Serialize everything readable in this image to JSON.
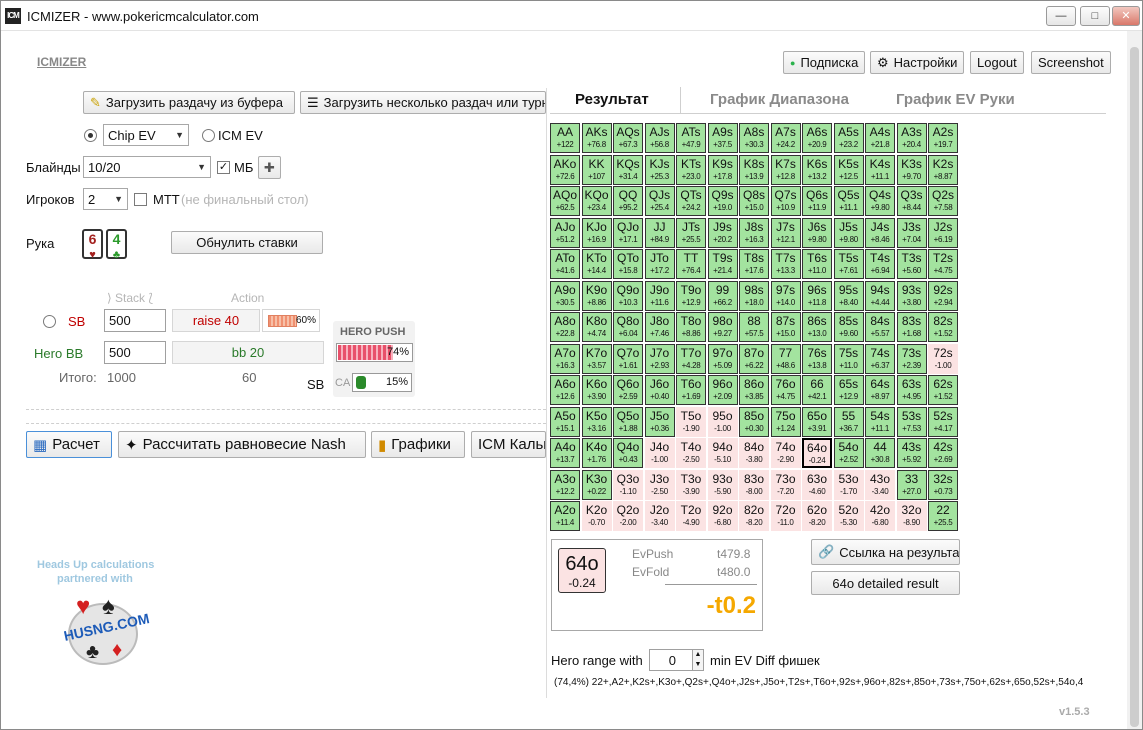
{
  "window": {
    "title": "ICMIZER - www.pokericmcalculator.com",
    "icon": "ICM"
  },
  "brand": "ICMIZER",
  "top_buttons": {
    "subscription": "Подписка",
    "settings": "Настройки",
    "logout": "Logout",
    "screenshot": "Screenshot"
  },
  "load_buttons": {
    "clipboard": "Загрузить раздачу из буфера",
    "multiple": "Загрузить несколько раздач или турнир"
  },
  "ev_mode": {
    "chip_ev": "Chip EV",
    "icm_ev": "ICM EV"
  },
  "blinds": {
    "label": "Блайнды",
    "value": "10/20",
    "bb_label": "МБ"
  },
  "players": {
    "label": "Игроков",
    "value": "2",
    "mtt_label": "МТТ",
    "mtt_note": "(не финальный стол)"
  },
  "hand": {
    "label": "Рука",
    "card1": "6",
    "card2": "4",
    "reset": "Обнулить ставки"
  },
  "columns": {
    "stack": "Stack",
    "action": "Action"
  },
  "sb": {
    "label": "SB",
    "stack": "500",
    "action": "raise 40",
    "percent": "60%"
  },
  "bb": {
    "label": "Hero",
    "pos": "BB",
    "stack": "500",
    "action": "bb 20"
  },
  "totals": {
    "label": "Итого:",
    "stack": "1000",
    "action": "60"
  },
  "hero_push": {
    "title": "HERO PUSH",
    "percent": "74%",
    "sb_label": "SB",
    "ca_label": "CA",
    "ca_percent": "15%",
    "push_fraction": 0.74,
    "ca_fraction": 0.15,
    "sb_fraction": 0.6
  },
  "action_buttons": {
    "calc": "Расчет",
    "nash": "Рассчитать равновесие Nash",
    "graphs": "Графики",
    "icm": "ICM Калькулятор"
  },
  "partner": {
    "line1": "Heads Up calculations",
    "line2": "partnered with",
    "logo": "HUSNG.COM"
  },
  "tabs": {
    "result": "Результат",
    "range": "График Диапазона",
    "ev": "График EV Руки"
  },
  "grid": [
    [
      [
        "AA",
        "+122",
        1
      ],
      [
        "AKs",
        "+76.8",
        1
      ],
      [
        "AQs",
        "+67.3",
        1
      ],
      [
        "AJs",
        "+56.8",
        1
      ],
      [
        "ATs",
        "+47.9",
        1
      ],
      [
        "A9s",
        "+37.5",
        1
      ],
      [
        "A8s",
        "+30.3",
        1
      ],
      [
        "A7s",
        "+24.2",
        1
      ],
      [
        "A6s",
        "+20.9",
        1
      ],
      [
        "A5s",
        "+23.2",
        1
      ],
      [
        "A4s",
        "+21.8",
        1
      ],
      [
        "A3s",
        "+20.4",
        1
      ],
      [
        "A2s",
        "+19.7",
        1
      ]
    ],
    [
      [
        "AKo",
        "+72.6",
        1
      ],
      [
        "KK",
        "+107",
        1
      ],
      [
        "KQs",
        "+31.4",
        1
      ],
      [
        "KJs",
        "+25.3",
        1
      ],
      [
        "KTs",
        "+23.0",
        1
      ],
      [
        "K9s",
        "+17.8",
        1
      ],
      [
        "K8s",
        "+13.9",
        1
      ],
      [
        "K7s",
        "+12.8",
        1
      ],
      [
        "K6s",
        "+13.2",
        1
      ],
      [
        "K5s",
        "+12.5",
        1
      ],
      [
        "K4s",
        "+11.1",
        1
      ],
      [
        "K3s",
        "+9.70",
        1
      ],
      [
        "K2s",
        "+8.87",
        1
      ]
    ],
    [
      [
        "AQo",
        "+62.5",
        1
      ],
      [
        "KQo",
        "+23.4",
        1
      ],
      [
        "QQ",
        "+95.2",
        1
      ],
      [
        "QJs",
        "+25.4",
        1
      ],
      [
        "QTs",
        "+24.2",
        1
      ],
      [
        "Q9s",
        "+19.0",
        1
      ],
      [
        "Q8s",
        "+15.0",
        1
      ],
      [
        "Q7s",
        "+10.9",
        1
      ],
      [
        "Q6s",
        "+11.9",
        1
      ],
      [
        "Q5s",
        "+11.1",
        1
      ],
      [
        "Q4s",
        "+9.80",
        1
      ],
      [
        "Q3s",
        "+8.44",
        1
      ],
      [
        "Q2s",
        "+7.58",
        1
      ]
    ],
    [
      [
        "AJo",
        "+51.2",
        1
      ],
      [
        "KJo",
        "+16.9",
        1
      ],
      [
        "QJo",
        "+17.1",
        1
      ],
      [
        "JJ",
        "+84.9",
        1
      ],
      [
        "JTs",
        "+25.5",
        1
      ],
      [
        "J9s",
        "+20.2",
        1
      ],
      [
        "J8s",
        "+16.3",
        1
      ],
      [
        "J7s",
        "+12.1",
        1
      ],
      [
        "J6s",
        "+9.80",
        1
      ],
      [
        "J5s",
        "+9.80",
        1
      ],
      [
        "J4s",
        "+8.46",
        1
      ],
      [
        "J3s",
        "+7.04",
        1
      ],
      [
        "J2s",
        "+6.19",
        1
      ]
    ],
    [
      [
        "ATo",
        "+41.6",
        1
      ],
      [
        "KTo",
        "+14.4",
        1
      ],
      [
        "QTo",
        "+15.8",
        1
      ],
      [
        "JTo",
        "+17.2",
        1
      ],
      [
        "TT",
        "+76.4",
        1
      ],
      [
        "T9s",
        "+21.4",
        1
      ],
      [
        "T8s",
        "+17.6",
        1
      ],
      [
        "T7s",
        "+13.3",
        1
      ],
      [
        "T6s",
        "+11.0",
        1
      ],
      [
        "T5s",
        "+7.61",
        1
      ],
      [
        "T4s",
        "+6.94",
        1
      ],
      [
        "T3s",
        "+5.60",
        1
      ],
      [
        "T2s",
        "+4.75",
        1
      ]
    ],
    [
      [
        "A9o",
        "+30.5",
        1
      ],
      [
        "K9o",
        "+8.86",
        1
      ],
      [
        "Q9o",
        "+10.3",
        1
      ],
      [
        "J9o",
        "+11.6",
        1
      ],
      [
        "T9o",
        "+12.9",
        1
      ],
      [
        "99",
        "+66.2",
        1
      ],
      [
        "98s",
        "+18.0",
        1
      ],
      [
        "97s",
        "+14.0",
        1
      ],
      [
        "96s",
        "+11.8",
        1
      ],
      [
        "95s",
        "+8.40",
        1
      ],
      [
        "94s",
        "+4.44",
        1
      ],
      [
        "93s",
        "+3.80",
        1
      ],
      [
        "92s",
        "+2.94",
        1
      ]
    ],
    [
      [
        "A8o",
        "+22.8",
        1
      ],
      [
        "K8o",
        "+4.74",
        1
      ],
      [
        "Q8o",
        "+6.04",
        1
      ],
      [
        "J8o",
        "+7.46",
        1
      ],
      [
        "T8o",
        "+8.86",
        1
      ],
      [
        "98o",
        "+9.27",
        1
      ],
      [
        "88",
        "+57.5",
        1
      ],
      [
        "87s",
        "+15.0",
        1
      ],
      [
        "86s",
        "+13.0",
        1
      ],
      [
        "85s",
        "+9.60",
        1
      ],
      [
        "84s",
        "+5.57",
        1
      ],
      [
        "83s",
        "+1.68",
        1
      ],
      [
        "82s",
        "+1.52",
        1
      ]
    ],
    [
      [
        "A7o",
        "+16.3",
        1
      ],
      [
        "K7o",
        "+3.57",
        1
      ],
      [
        "Q7o",
        "+1.61",
        1
      ],
      [
        "J7o",
        "+2.93",
        1
      ],
      [
        "T7o",
        "+4.28",
        1
      ],
      [
        "97o",
        "+5.09",
        1
      ],
      [
        "87o",
        "+6.22",
        1
      ],
      [
        "77",
        "+48.6",
        1
      ],
      [
        "76s",
        "+13.8",
        1
      ],
      [
        "75s",
        "+11.0",
        1
      ],
      [
        "74s",
        "+6.37",
        1
      ],
      [
        "73s",
        "+2.39",
        1
      ],
      [
        "72s",
        "-1.00",
        0
      ]
    ],
    [
      [
        "A6o",
        "+12.6",
        1
      ],
      [
        "K6o",
        "+3.90",
        1
      ],
      [
        "Q6o",
        "+2.59",
        1
      ],
      [
        "J6o",
        "+0.40",
        1
      ],
      [
        "T6o",
        "+1.69",
        1
      ],
      [
        "96o",
        "+2.09",
        1
      ],
      [
        "86o",
        "+3.85",
        1
      ],
      [
        "76o",
        "+4.75",
        1
      ],
      [
        "66",
        "+42.1",
        1
      ],
      [
        "65s",
        "+12.9",
        1
      ],
      [
        "64s",
        "+8.97",
        1
      ],
      [
        "63s",
        "+4.95",
        1
      ],
      [
        "62s",
        "+1.52",
        1
      ]
    ],
    [
      [
        "A5o",
        "+15.1",
        1
      ],
      [
        "K5o",
        "+3.16",
        1
      ],
      [
        "Q5o",
        "+1.88",
        1
      ],
      [
        "J5o",
        "+0.36",
        1
      ],
      [
        "T5o",
        "-1.90",
        0
      ],
      [
        "95o",
        "-1.00",
        0
      ],
      [
        "85o",
        "+0.30",
        1
      ],
      [
        "75o",
        "+1.24",
        1
      ],
      [
        "65o",
        "+3.91",
        1
      ],
      [
        "55",
        "+36.7",
        1
      ],
      [
        "54s",
        "+11.1",
        1
      ],
      [
        "53s",
        "+7.53",
        1
      ],
      [
        "52s",
        "+4.17",
        1
      ]
    ],
    [
      [
        "A4o",
        "+13.7",
        1
      ],
      [
        "K4o",
        "+1.76",
        1
      ],
      [
        "Q4o",
        "+0.43",
        1
      ],
      [
        "J4o",
        "-1.00",
        0
      ],
      [
        "T4o",
        "-2.50",
        0
      ],
      [
        "94o",
        "-5.10",
        0
      ],
      [
        "84o",
        "-3.80",
        0
      ],
      [
        "74o",
        "-2.90",
        0
      ],
      [
        "64o",
        "-0.24",
        2
      ],
      [
        "54o",
        "+2.52",
        1
      ],
      [
        "44",
        "+30.8",
        1
      ],
      [
        "43s",
        "+5.92",
        1
      ],
      [
        "42s",
        "+2.69",
        1
      ]
    ],
    [
      [
        "A3o",
        "+12.2",
        1
      ],
      [
        "K3o",
        "+0.22",
        1
      ],
      [
        "Q3o",
        "-1.10",
        0
      ],
      [
        "J3o",
        "-2.50",
        0
      ],
      [
        "T3o",
        "-3.90",
        0
      ],
      [
        "93o",
        "-5.90",
        0
      ],
      [
        "83o",
        "-8.00",
        0
      ],
      [
        "73o",
        "-7.20",
        0
      ],
      [
        "63o",
        "-4.60",
        0
      ],
      [
        "53o",
        "-1.70",
        0
      ],
      [
        "43o",
        "-3.40",
        0
      ],
      [
        "33",
        "+27.0",
        1
      ],
      [
        "32s",
        "+0.73",
        1
      ]
    ],
    [
      [
        "A2o",
        "+11.4",
        1
      ],
      [
        "K2o",
        "-0.70",
        0
      ],
      [
        "Q2o",
        "-2.00",
        0
      ],
      [
        "J2o",
        "-3.40",
        0
      ],
      [
        "T2o",
        "-4.90",
        0
      ],
      [
        "92o",
        "-6.80",
        0
      ],
      [
        "82o",
        "-8.20",
        0
      ],
      [
        "72o",
        "-11.0",
        0
      ],
      [
        "62o",
        "-8.20",
        0
      ],
      [
        "52o",
        "-5.30",
        0
      ],
      [
        "42o",
        "-6.80",
        0
      ],
      [
        "32o",
        "-8.90",
        0
      ],
      [
        "22",
        "+25.5",
        1
      ]
    ]
  ],
  "result": {
    "hand": "64o",
    "diff": "-0.24",
    "evpush_label": "EvPush",
    "evpush": "t479.8",
    "evfold_label": "EvFold",
    "evfold": "t480.0",
    "total": "-t0.2"
  },
  "links": {
    "share": "Ссылка на результат",
    "detailed": "64o detailed result"
  },
  "hero_range": {
    "label": "Hero range with",
    "value": "0",
    "suffix": "min EV Diff фишек",
    "text": "(74,4%) 22+,A2+,K2s+,K3o+,Q2s+,Q4o+,J2s+,J5o+,T2s+,T6o+,92s+,96o+,82s+,85o+,73s+,75o+,62s+,65o,52s+,54o,4"
  },
  "version": "v1.5.3",
  "colors": {
    "positive": "#a3e39f",
    "negative": "#fbe3e3",
    "accent": "#f5a800",
    "sb_red": "#c00000",
    "hero_green": "#2a7a2a"
  }
}
